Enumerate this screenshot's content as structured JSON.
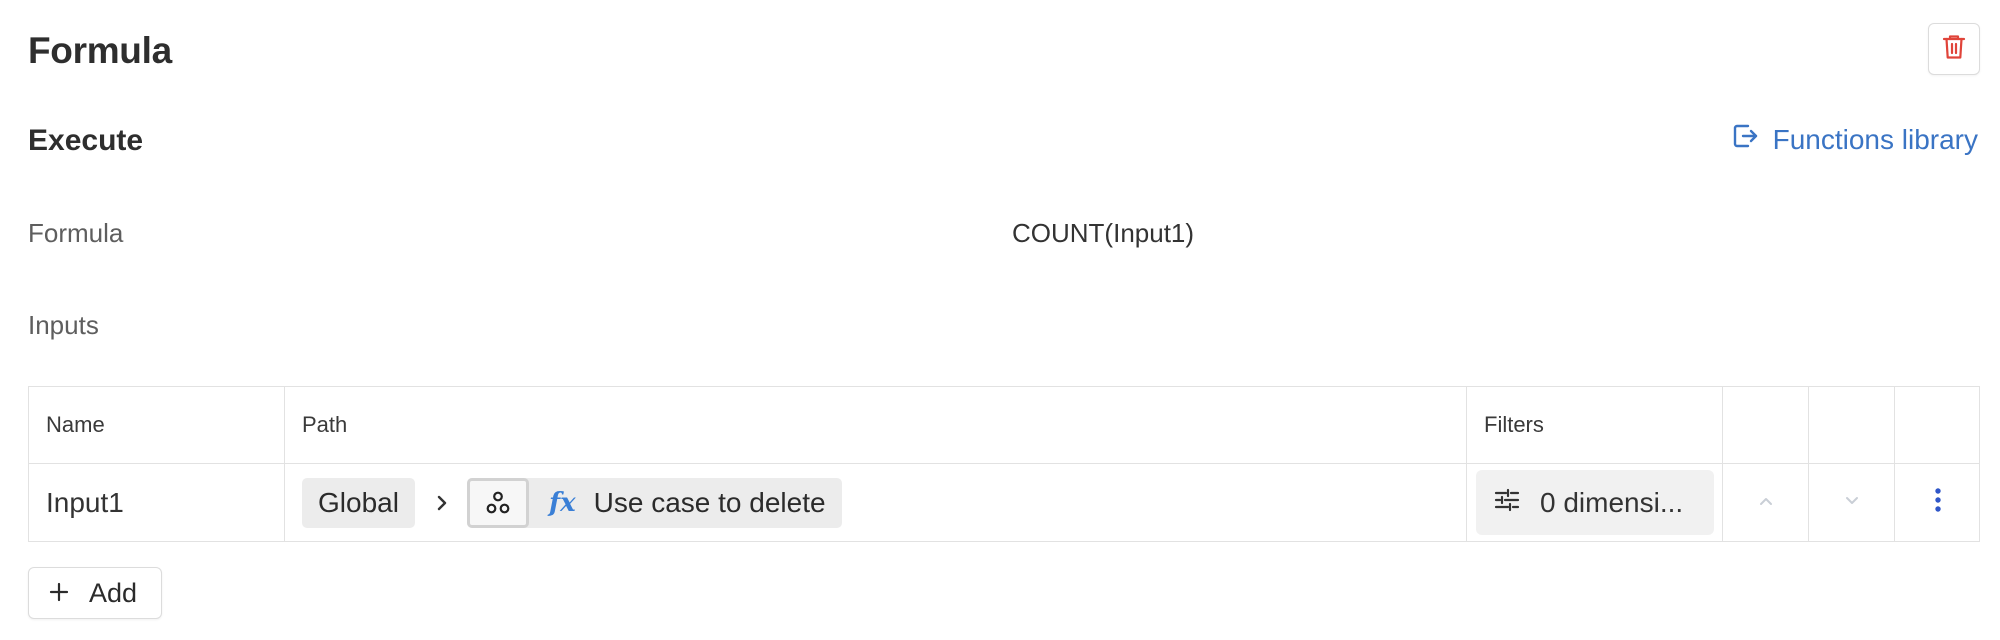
{
  "header": {
    "title": "Formula",
    "delete_icon": "trash-icon",
    "delete_color": "#e0443a"
  },
  "execute": {
    "title": "Execute",
    "functions_library_label": "Functions library",
    "link_color": "#3a74c4"
  },
  "fields": {
    "formula_label": "Formula",
    "formula_value": "COUNT(Input1)",
    "inputs_label": "Inputs"
  },
  "table": {
    "columns": [
      "Name",
      "Path",
      "Filters"
    ],
    "rows": [
      {
        "name": "Input1",
        "path_root": "Global",
        "path_item_icon": "fx-icon",
        "path_item": "Use case to delete",
        "filters": "0 dimensi..."
      }
    ]
  },
  "add_label": "Add"
}
